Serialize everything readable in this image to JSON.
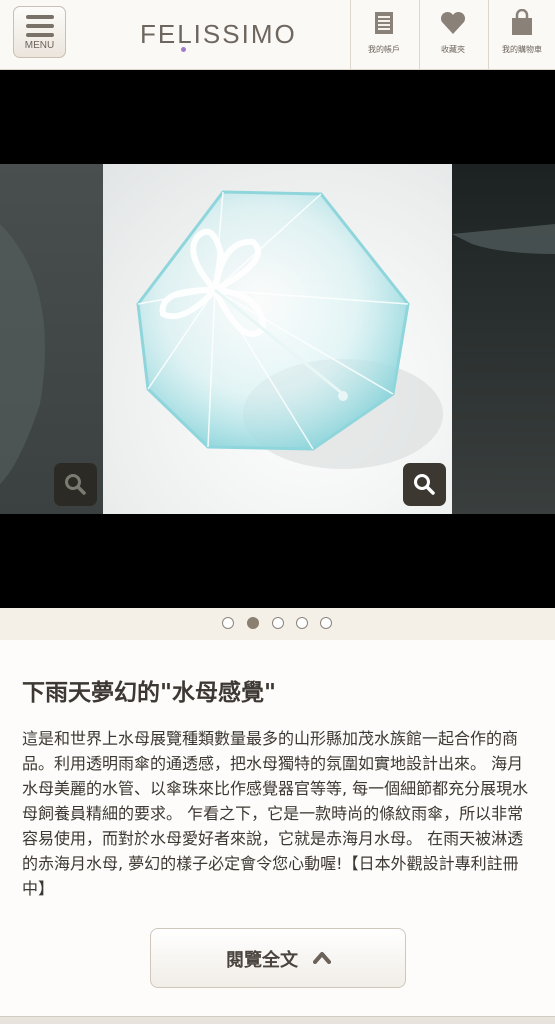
{
  "header": {
    "menu_label": "MENU",
    "logo": "FELISSIMO",
    "icons": [
      {
        "label": "我的帳戶",
        "icon": "account-book-icon"
      },
      {
        "label": "收藏夾",
        "icon": "heart-icon"
      },
      {
        "label": "我的購物車",
        "icon": "shopping-bag-icon"
      }
    ]
  },
  "carousel": {
    "slide_count": 5,
    "active_index": 1
  },
  "product": {
    "title": "下雨天夢幻的\"水母感覺\"",
    "description": "這是和世界上水母展覽種類數量最多的山形縣加茂水族館一起合作的商品。利用透明雨傘的通透感，把水母獨特的氛圍如實地設計出來。 海月水母美麗的水管、以傘珠來比作感覺器官等等, 每一個細節都充分展現水母飼養員精細的要求。 乍看之下，它是一款時尚的條紋雨傘，所以非常容易使用，而對於水母愛好者來說，它就是赤海月水母。 在雨天被淋透的赤海月水母, 夢幻的樣子必定會令您心動喔!【日本外觀設計專利註冊中】",
    "read_more_label": "閱覽全文"
  },
  "colors": {
    "header_bg": "#fbf9f6",
    "page_bg": "#f6f2ec",
    "text": "#3d3833",
    "umbrella": "#9fdce0"
  }
}
